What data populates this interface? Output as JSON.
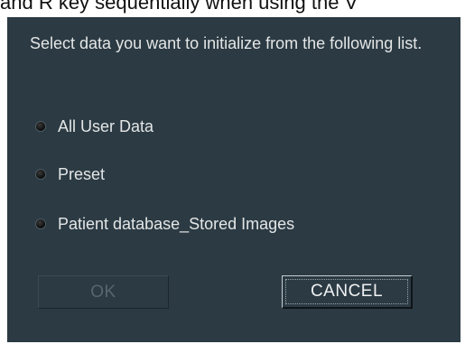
{
  "caption": "and R key sequentially when using the V",
  "dialog": {
    "prompt": "Select data you want to initialize from the following list.",
    "options": [
      {
        "label": "All User Data"
      },
      {
        "label": "Preset"
      },
      {
        "label": "Patient database_Stored Images"
      }
    ],
    "buttons": {
      "ok": "OK",
      "cancel": "CANCEL"
    }
  }
}
